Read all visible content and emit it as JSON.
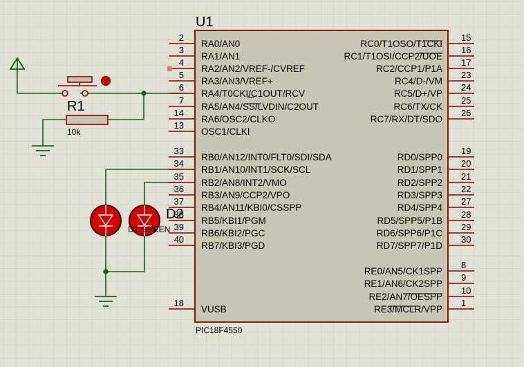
{
  "chip": {
    "ref": "U1",
    "part": "PIC18F4550",
    "left_pins": [
      {
        "num": "2",
        "label": "RA0/AN0"
      },
      {
        "num": "3",
        "label": "RA1/AN1"
      },
      {
        "num": "4",
        "label": "RA2/AN2/VREF-/CVREF"
      },
      {
        "num": "5",
        "label": "RA3/AN3/VREF+"
      },
      {
        "num": "6",
        "label": "RA4/T0CKI/C1OUT/RCV"
      },
      {
        "num": "7",
        "label": "RA5/AN4/SS/LVDIN/C2OUT"
      },
      {
        "num": "14",
        "label": "RA6/OSC2/CLKO"
      },
      {
        "num": "13",
        "label": "OSC1/CLKI"
      },
      {
        "num": "33",
        "label": "RB0/AN12/INT0/FLT0/SDI/SDA"
      },
      {
        "num": "34",
        "label": "RB1/AN10/INT1/SCK/SCL"
      },
      {
        "num": "35",
        "label": "RB2/AN8/INT2/VMO"
      },
      {
        "num": "36",
        "label": "RB3/AN9/CCP2/VPO"
      },
      {
        "num": "37",
        "label": "RB4/AN11/KBI0/CSSPP"
      },
      {
        "num": "38",
        "label": "RB5/KBI1/PGM"
      },
      {
        "num": "39",
        "label": "RB6/KBI2/PGC"
      },
      {
        "num": "40",
        "label": "RB7/KBI3/PGD"
      },
      {
        "num": "18",
        "label": "VUSB"
      }
    ],
    "right_pins": [
      {
        "num": "15",
        "label": "RC0/T1OSO/T1CKI"
      },
      {
        "num": "16",
        "label": "RC1/T1OSI/CCP2/UOE"
      },
      {
        "num": "17",
        "label": "RC2/CCP1/P1A"
      },
      {
        "num": "23",
        "label": "RC4/D-/VM"
      },
      {
        "num": "24",
        "label": "RC5/D+/VP"
      },
      {
        "num": "25",
        "label": "RC6/TX/CK"
      },
      {
        "num": "26",
        "label": "RC7/RX/DT/SDO"
      },
      {
        "num": "19",
        "label": "RD0/SPP0"
      },
      {
        "num": "20",
        "label": "RD1/SPP1"
      },
      {
        "num": "21",
        "label": "RD2/SPP2"
      },
      {
        "num": "22",
        "label": "RD3/SPP3"
      },
      {
        "num": "27",
        "label": "RD4/SPP4"
      },
      {
        "num": "28",
        "label": "RD5/SPP5/P1B"
      },
      {
        "num": "29",
        "label": "RD6/SPP6/P1C"
      },
      {
        "num": "30",
        "label": "RD7/SPP7/P1D"
      },
      {
        "num": "8",
        "label": "RE0/AN5/CK1SPP"
      },
      {
        "num": "9",
        "label": "RE1/AN6/CK2SPP"
      },
      {
        "num": "10",
        "label": "RE2/AN7/OESPP"
      },
      {
        "num": "1",
        "label": "RE3/MCLR/VPP"
      }
    ]
  },
  "resistor": {
    "ref": "R1",
    "value": "10k"
  },
  "leds": {
    "d2_ref": "D2",
    "overlap_text": "D1 GREEN"
  },
  "colors": {
    "background": "#e1e1d6",
    "grid": "#c9c9bc",
    "wire": "#1d5e1d",
    "component": "#8b0000",
    "chip_fill": "#c8c6b5",
    "led_fill": "#d40000"
  }
}
